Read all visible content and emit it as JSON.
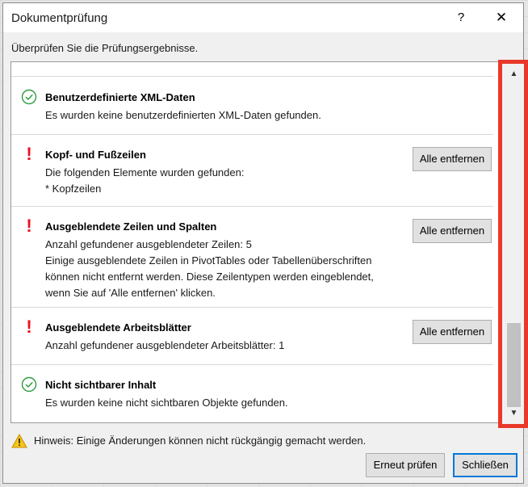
{
  "window": {
    "title": "Dokumentprüfung",
    "help_glyph": "?",
    "close_glyph": "✕"
  },
  "instruction": "Überprüfen Sie die Prüfungsergebnisse.",
  "results": [
    {
      "status": "ok",
      "title": "Benutzerdefinierte XML-Daten",
      "text": "Es wurden keine benutzerdefinierten XML-Daten gefunden."
    },
    {
      "status": "warning",
      "title": "Kopf- und Fußzeilen",
      "text": "Die folgenden Elemente wurden gefunden:\n* Kopfzeilen",
      "button": "Alle entfernen"
    },
    {
      "status": "warning",
      "title": "Ausgeblendete Zeilen und Spalten",
      "text": "Anzahl gefundener ausgeblendeter Zeilen: 5\nEinige ausgeblendete Zeilen in PivotTables oder Tabellenüberschriften können nicht entfernt werden. Diese Zeilentypen werden eingeblendet, wenn Sie auf 'Alle entfernen' klicken.",
      "button": "Alle entfernen"
    },
    {
      "status": "warning",
      "title": "Ausgeblendete Arbeitsblätter",
      "text": "Anzahl gefundener ausgeblendeter Arbeitsblätter: 1",
      "button": "Alle entfernen"
    },
    {
      "status": "ok",
      "title": "Nicht sichtbarer Inhalt",
      "text": "Es wurden keine nicht sichtbaren Objekte gefunden."
    }
  ],
  "scrollbar": {
    "up_glyph": "▲",
    "down_glyph": "▼",
    "highlight_color": "#e8382a"
  },
  "hint": "Hinweis: Einige Änderungen können nicht rückgängig gemacht werden.",
  "buttons": {
    "recheck": "Erneut prüfen",
    "close": "Schließen"
  },
  "colors": {
    "ok_green": "#2e9c3f",
    "warning_red": "#e81123",
    "accent_blue": "#0078d7"
  }
}
